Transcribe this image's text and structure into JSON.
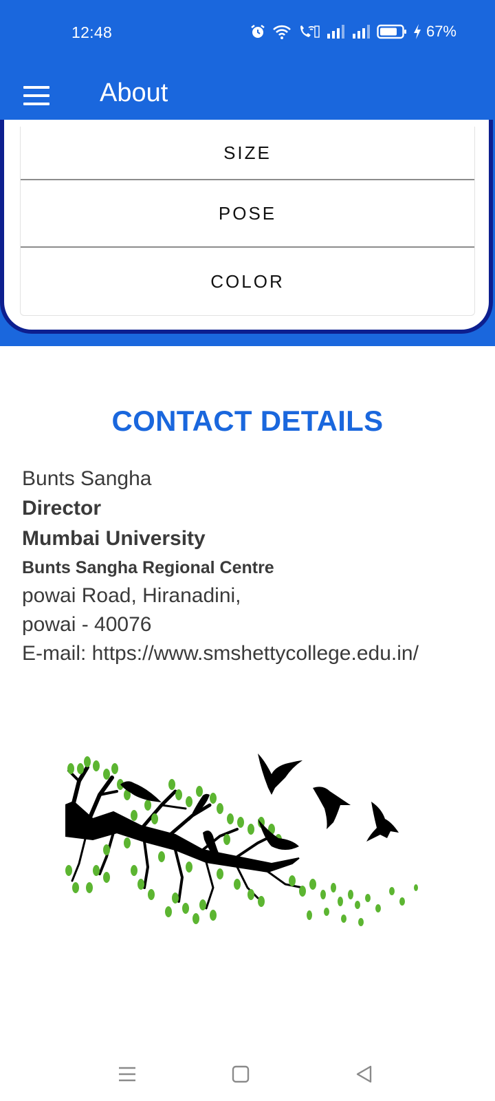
{
  "status": {
    "time": "12:48",
    "battery_pct": "67%",
    "icons": [
      "alarm-icon",
      "wifi-icon",
      "vowifi-call-icon",
      "signal-icon",
      "signal-icon",
      "battery-icon",
      "charging-icon"
    ]
  },
  "app_bar": {
    "title": "About",
    "menu_icon": "hamburger-menu-icon"
  },
  "options": [
    "SIZE",
    "POSE",
    "COLOR"
  ],
  "contact": {
    "heading": "CONTACT DETAILS",
    "name": "Bunts Sangha",
    "role": "Director",
    "university": "Mumbai University",
    "centre": "Bunts Sangha Regional Centre",
    "address_line1": "powai Road, Hiranadini,",
    "address_line2": "powai - 40076",
    "email": "E-mail: https://www.smshettycollege.edu.in/"
  },
  "illustration": "tree-branch-with-birds-illustration",
  "nav": {
    "icons": [
      "recents-icon",
      "home-icon",
      "back-icon"
    ]
  },
  "colors": {
    "primary": "#1a67dd",
    "card_border": "#0d1f8f",
    "leaf_green": "#5cb531",
    "text_dark": "#3a3a3a"
  }
}
